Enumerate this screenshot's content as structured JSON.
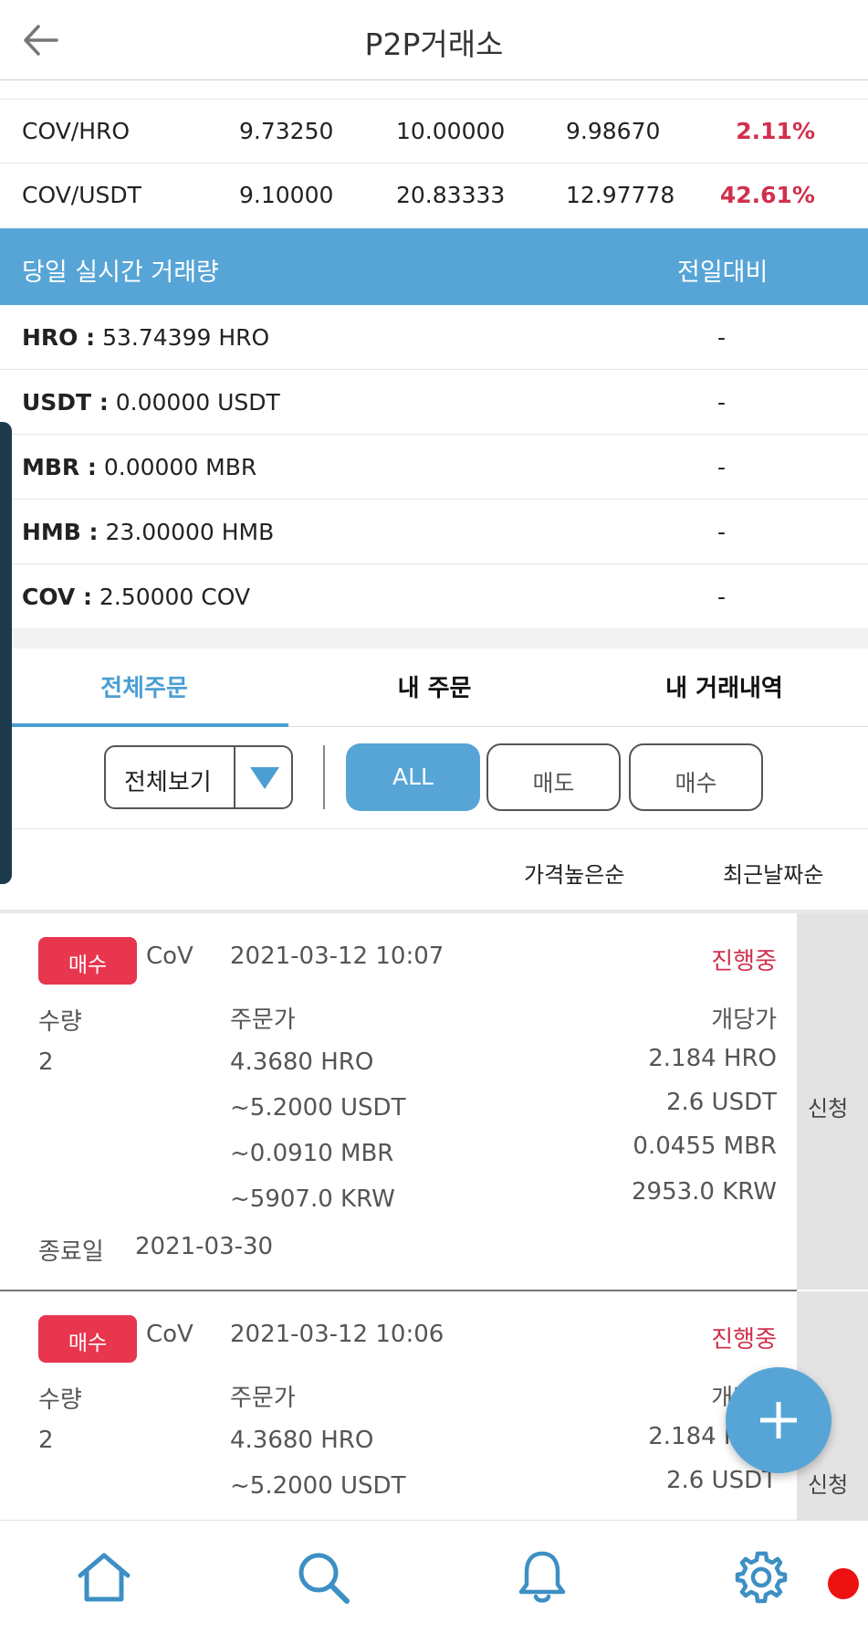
{
  "header": {
    "title": "P2P거래소",
    "back_icon": "arrow-left-icon"
  },
  "pairs": [
    {
      "name": "COV/HRO",
      "v1": "9.73250",
      "v2": "10.00000",
      "v3": "9.98670",
      "change": "2.11%"
    },
    {
      "name": "COV/USDT",
      "v1": "9.10000",
      "v2": "20.83333",
      "v3": "12.97778",
      "change": "42.61%"
    }
  ],
  "volume": {
    "title": "당일 실시간 거래량",
    "compare_label": "전일대비",
    "rows": [
      {
        "coin": "HRO :",
        "amount": " 53.74399 HRO",
        "change": "-"
      },
      {
        "coin": "USDT :",
        "amount": " 0.00000 USDT",
        "change": "-"
      },
      {
        "coin": "MBR :",
        "amount": " 0.00000 MBR",
        "change": "-"
      },
      {
        "coin": "HMB :",
        "amount": " 23.00000 HMB",
        "change": "-"
      },
      {
        "coin": "COV :",
        "amount": " 2.50000 COV",
        "change": "-"
      }
    ]
  },
  "tabs": [
    "전체주문",
    "내 주문",
    "내 거래내역"
  ],
  "filter": {
    "select_value": "전체보기",
    "buttons": [
      "ALL",
      "매도",
      "매수"
    ]
  },
  "sort": {
    "price": "가격높은순",
    "date": "최근날짜순"
  },
  "orders": [
    {
      "type": "매수",
      "coin": "CoV",
      "datetime": "2021-03-12 10:07",
      "status": "진행중",
      "qty_label": "수량",
      "qty": "2",
      "price_label": "주문가",
      "prices": [
        "4.3680 HRO",
        "~5.2000 USDT",
        "~0.0910 MBR",
        "~5907.0 KRW"
      ],
      "unit_label": "개당가",
      "unit_prices": [
        "2.184 HRO",
        "2.6 USDT",
        "0.0455 MBR",
        "2953.0 KRW"
      ],
      "end_label": "종료일",
      "end_date": "2021-03-30",
      "apply": "신청"
    },
    {
      "type": "매수",
      "coin": "CoV",
      "datetime": "2021-03-12 10:06",
      "status": "진행중",
      "qty_label": "수량",
      "qty": "2",
      "price_label": "주문가",
      "prices": [
        "4.3680 HRO",
        "~5.2000 USDT"
      ],
      "unit_label": "개당가",
      "unit_prices": [
        "2.184 HRO",
        "2.6 USDT"
      ],
      "apply": "신청"
    }
  ],
  "colors": {
    "accent": "#57a5d6",
    "red": "#d0304e",
    "badge": "#e8364f",
    "nav_icon": "#3d8fc4"
  },
  "nav": [
    "home-icon",
    "search-icon",
    "bell-icon",
    "gear-icon"
  ]
}
